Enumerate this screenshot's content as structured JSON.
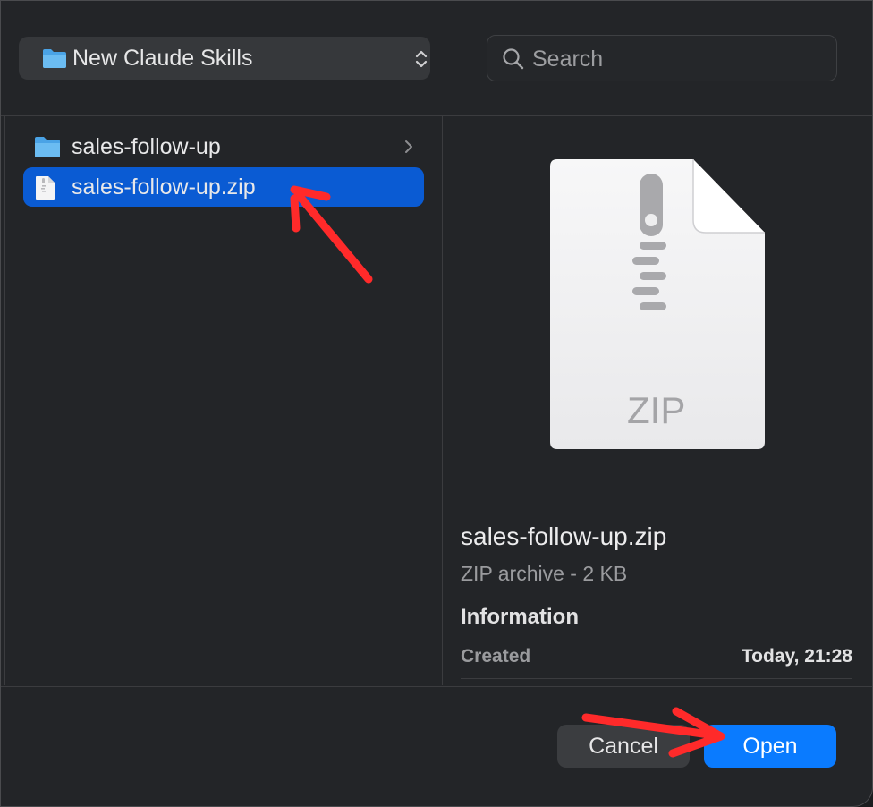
{
  "toolbar": {
    "location": "New Claude Skills",
    "search_placeholder": "Search"
  },
  "browser": {
    "items": [
      {
        "name": "sales-follow-up",
        "kind": "folder",
        "selected": false
      },
      {
        "name": "sales-follow-up.zip",
        "kind": "zip",
        "selected": true
      }
    ]
  },
  "preview": {
    "icon_label": "ZIP",
    "file_name": "sales-follow-up.zip",
    "kind_size": "ZIP archive - 2 KB",
    "info_title": "Information",
    "created_label": "Created",
    "created_value": "Today, 21:28"
  },
  "buttons": {
    "cancel": "Cancel",
    "open": "Open"
  },
  "colors": {
    "accent": "#0a7bff",
    "selection": "#0a5bd3",
    "annotation_arrow": "#ff2a2a"
  }
}
